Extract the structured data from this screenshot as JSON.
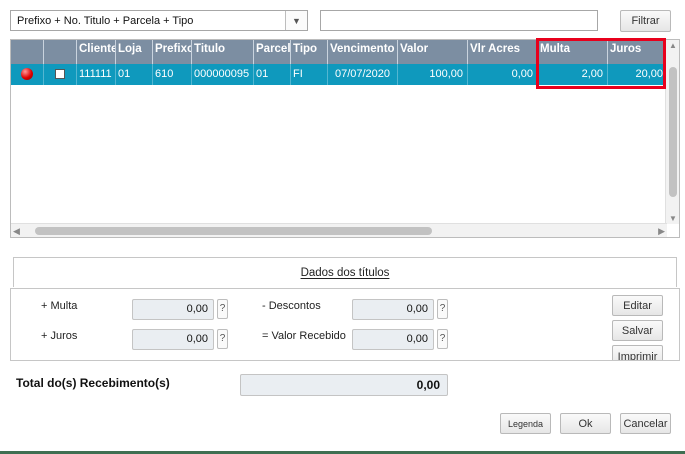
{
  "filter_bar": {
    "index_selected": "Prefixo + No. Titulo + Parcela + Tipo",
    "search_value": "",
    "filter_button": "Filtrar"
  },
  "grid": {
    "columns": [
      "",
      "",
      "Cliente",
      "Loja",
      "Prefixo",
      "Titulo",
      "Parcela",
      "Tipo",
      "Vencimento",
      "Valor",
      "Vlr Acres",
      "Multa",
      "Juros"
    ],
    "rows": [
      {
        "status": "red-status-icon",
        "checked": false,
        "cells": [
          "111111",
          "01",
          "610",
          "000000095",
          "01",
          "FI",
          "07/07/2020",
          "100,00",
          "0,00",
          "2,00",
          "20,00"
        ]
      }
    ]
  },
  "panel": {
    "title": "Dados dos títulos",
    "multa_label": "+ Multa",
    "multa_value": "0,00",
    "juros_label": "+ Juros",
    "juros_value": "0,00",
    "descontos_label": "- Descontos",
    "descontos_value": "0,00",
    "valor_recebido_label": "= Valor Recebido",
    "valor_recebido_value": "0,00",
    "help": "?",
    "editar_button": "Editar",
    "salvar_button": "Salvar",
    "imprimir_button": "Imprimir"
  },
  "total": {
    "label": "Total do(s) Recebimento(s)",
    "value": "0,00"
  },
  "footer": {
    "legenda_button": "Legenda",
    "ok_button": "Ok",
    "cancelar_button": "Cancelar"
  },
  "colors": {
    "header_bg": "#7c8ea2",
    "selected_row_bg": "#0f99bd",
    "highlight": "#e8001c"
  }
}
